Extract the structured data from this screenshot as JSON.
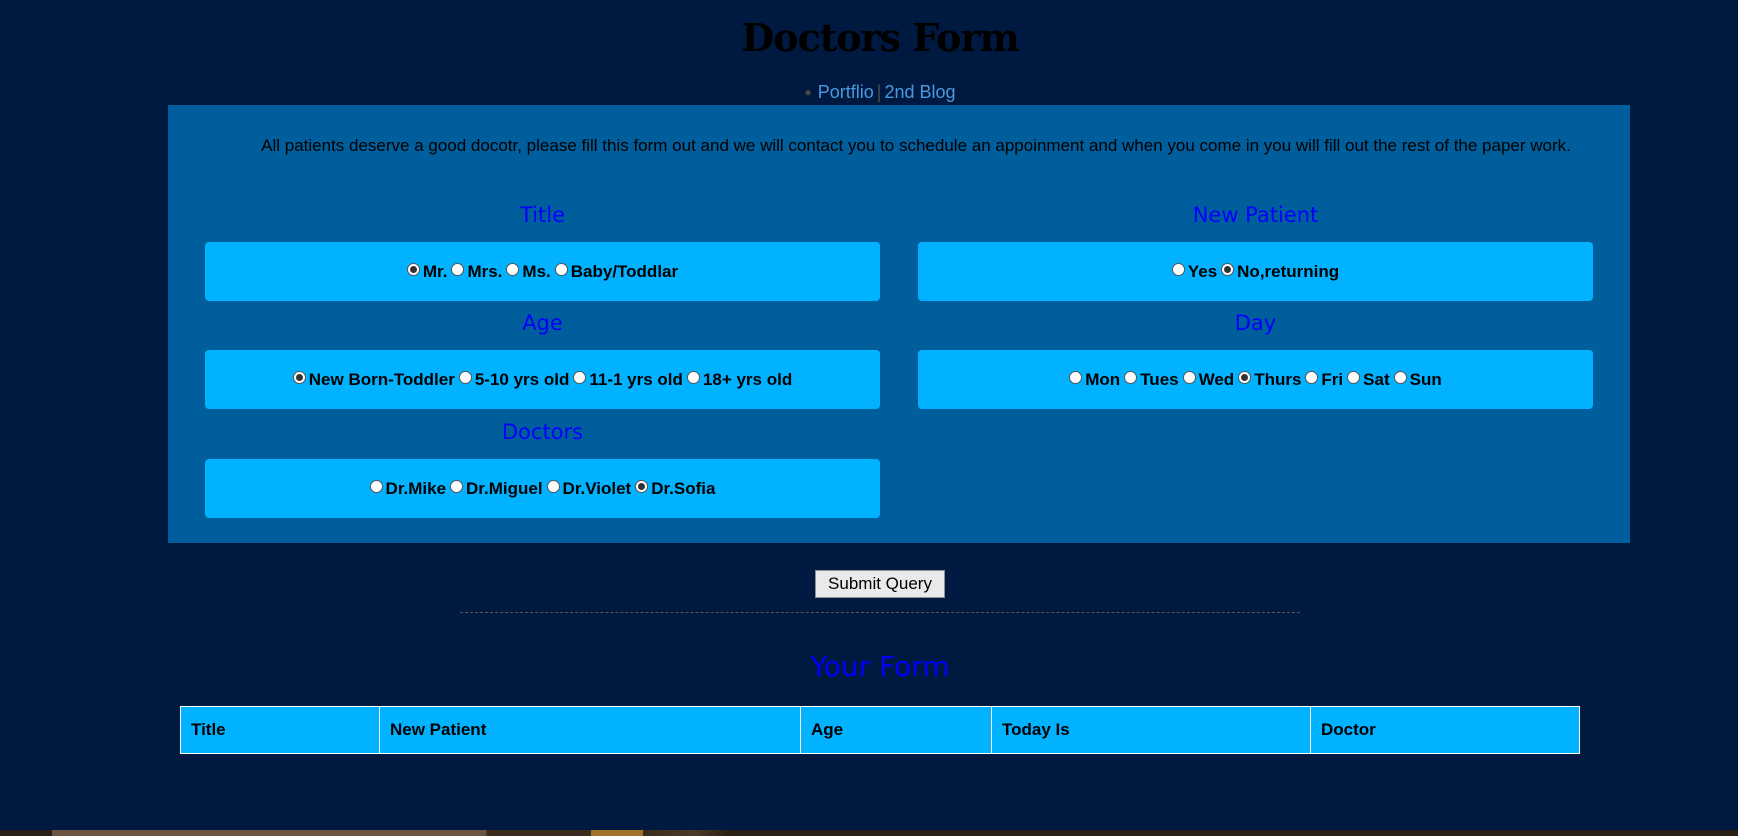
{
  "page": {
    "title": "Doctors Form",
    "nav": {
      "links": [
        "Portflio",
        "2nd Blog"
      ],
      "separator": "|"
    },
    "intro": "All patients deserve a good docotr, please fill this form out and we will contact you to schedule an appoinment and when you come in you will fill out the rest of the paper work."
  },
  "form": {
    "title": {
      "legend": "Title",
      "options": [
        "Mr.",
        "Mrs.",
        "Ms.",
        "Baby/Toddlar"
      ],
      "selected": "Mr."
    },
    "new_patient": {
      "legend": "New Patient",
      "options": [
        "Yes",
        "No,returning"
      ],
      "selected": "No,returning"
    },
    "age": {
      "legend": "Age",
      "options": [
        "New Born-Toddler",
        "5-10 yrs old",
        "11-1 yrs old",
        "18+ yrs old"
      ],
      "selected": "New Born-Toddler"
    },
    "day": {
      "legend": "Day",
      "options": [
        "Mon",
        "Tues",
        "Wed",
        "Thurs",
        "Fri",
        "Sat",
        "Sun"
      ],
      "selected": "Thurs"
    },
    "doctors": {
      "legend": "Doctors",
      "options": [
        "Dr.Mike",
        "Dr.Miguel",
        "Dr.Violet",
        "Dr.Sofia"
      ],
      "selected": "Dr.Sofia"
    },
    "submit_label": "Submit Query"
  },
  "results": {
    "heading": "Your Form",
    "columns": [
      "Title",
      "New Patient",
      "Age",
      "Today Is",
      "Doctor"
    ]
  },
  "colors": {
    "background": "#001940",
    "panel": "#015e9c",
    "option_box": "#00b2ff",
    "legend_text": "#0000ff",
    "link": "#4a9ae0"
  }
}
